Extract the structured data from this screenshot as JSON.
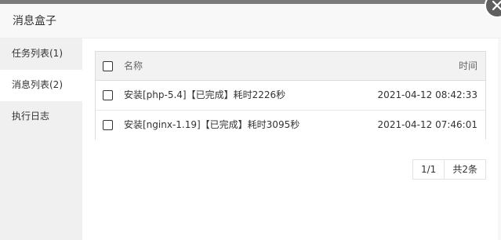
{
  "dialog": {
    "title": "消息盒子",
    "close_icon": "close-icon"
  },
  "sidebar": {
    "items": [
      {
        "label": "任务列表(1)",
        "active": false
      },
      {
        "label": "消息列表(2)",
        "active": true
      },
      {
        "label": "执行日志",
        "active": false
      }
    ]
  },
  "table": {
    "headers": {
      "name": "名称",
      "time": "时间"
    },
    "rows": [
      {
        "name": "安装[php-5.4]【已完成】耗时2226秒",
        "time": "2021-04-12 08:42:33"
      },
      {
        "name": "安装[nginx-1.19]【已完成】耗时3095秒",
        "time": "2021-04-12 07:46:01"
      }
    ]
  },
  "pagination": {
    "page": "1/1",
    "total": "共2条"
  },
  "colors": {
    "header_bg": "#f8f8f8",
    "sidebar_bg": "#f0f0f0",
    "active_item_bg": "#ffffff",
    "table_head_bg": "#f2f2f2",
    "border": "#dddddd",
    "close_bg": "#5f5f5f"
  }
}
